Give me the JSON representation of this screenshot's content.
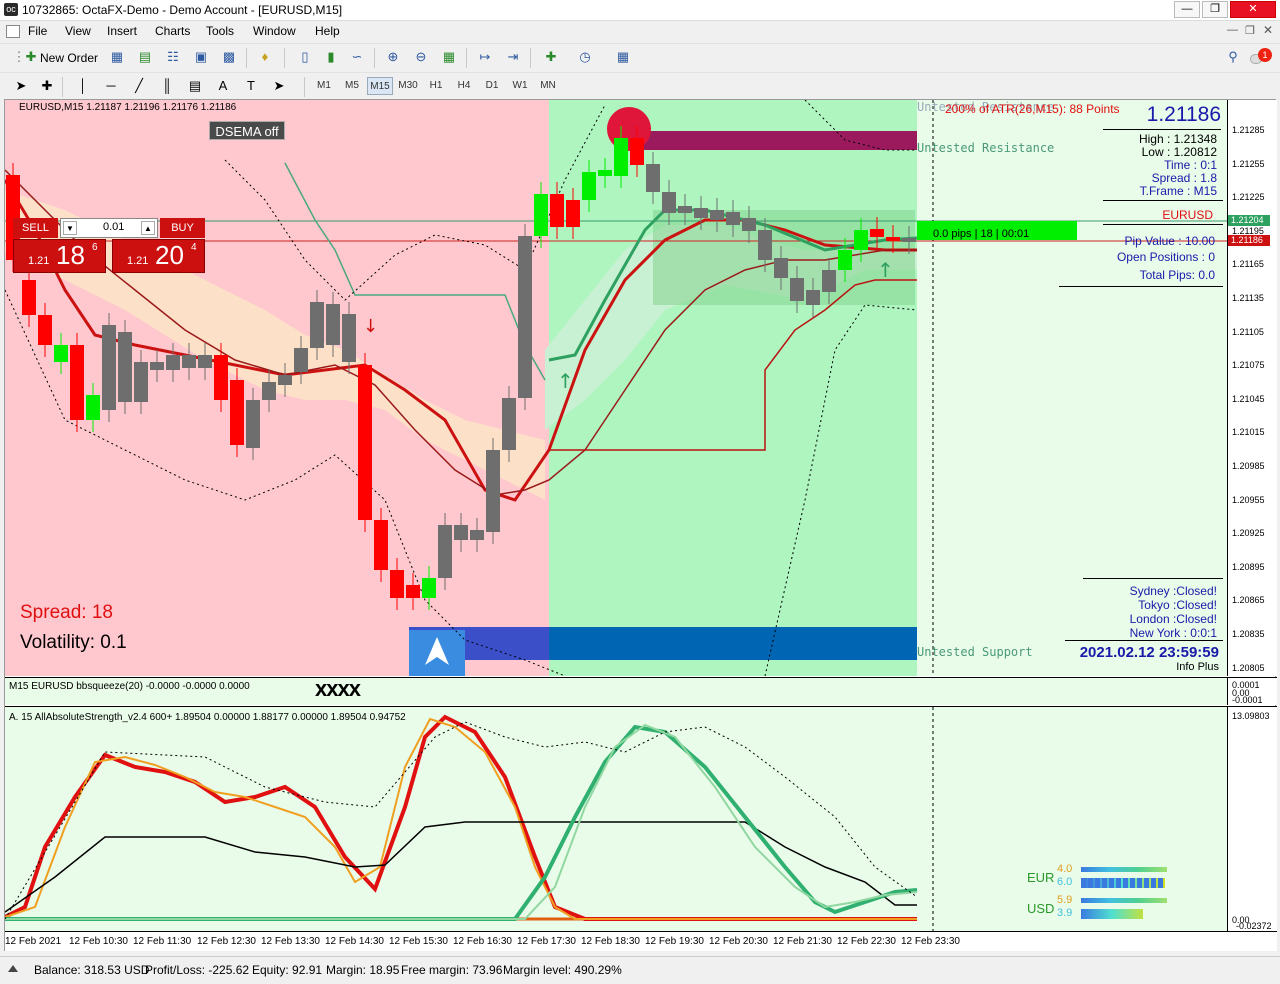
{
  "window": {
    "title": "10732865: OctaFX-Demo - Demo Account - [EURUSD,M15]",
    "app_icon": "oc"
  },
  "menu": [
    "File",
    "View",
    "Insert",
    "Charts",
    "Tools",
    "Window",
    "Help"
  ],
  "toolbar": {
    "new_order": "New Order"
  },
  "timeframes": [
    "M1",
    "M5",
    "M15",
    "M30",
    "H1",
    "H4",
    "D1",
    "W1",
    "MN"
  ],
  "active_timeframe": "M15",
  "chart": {
    "header": "EURUSD,M15  1.21187 1.21196 1.21176 1.21186",
    "dsema_button": "DSEMA off",
    "trade": {
      "sell_label": "SELL",
      "buy_label": "BUY",
      "lot": "0.01",
      "sell_small": "1.21",
      "sell_big": "18",
      "sell_sup": "6",
      "buy_small": "1.21",
      "buy_big": "20",
      "buy_sup": "4"
    },
    "spread_label": "Spread: 18",
    "volatility_label": "Volatility: 0.1",
    "atr_label": "200% of ATR(26,M15): 88  Points",
    "untested_resistance": "Untested Resistance",
    "untested_support": "Untested Support",
    "untested_top": "Untested Resistance",
    "pips_bar": "0.0 pips | 18 | 00:01",
    "info": {
      "price": "1.21186",
      "high": "High : 1.21348",
      "low": "Low : 1.20812",
      "time": "Time :      0:1",
      "spread": "Spread :       1.8",
      "tframe": "T.Frame :    M15",
      "symbol": "EURUSD",
      "pip_value": "Pip Value :   10.00",
      "open_positions": "Open Positions :       0",
      "total_pips": "Total Pips:      0.0"
    },
    "sessions": {
      "sydney": "Sydney :Closed!",
      "tokyo": "Tokyo :Closed!",
      "london": "London :Closed!",
      "newyork": "New York :     0:0:1",
      "datetime": "2021.02.12 23:59:59",
      "info_plus": "Info Plus"
    }
  },
  "price_scale": [
    "1.21285",
    "1.21255",
    "1.21225",
    "1.21195",
    "1.21165",
    "1.21135",
    "1.21105",
    "1.21075",
    "1.21045",
    "1.21015",
    "1.20985",
    "1.20955",
    "1.20925",
    "1.20895",
    "1.20865",
    "1.20835",
    "1.20805"
  ],
  "price_tags": {
    "green": "1.21204",
    "red": "1.21186"
  },
  "sub1": {
    "label": "M15 EURUSD bbsqueeze(20) -0.0000 -0.0000 0.0000",
    "marks": "xxxx",
    "scale": [
      "0.0001",
      "0.00",
      "-0.0001"
    ]
  },
  "sub2": {
    "label": "A. 15 AllAbsoluteStrength_v2.4 600+ 1.89504 0.00000 1.88177 0.00000 1.89504 0.94752",
    "scale_top": "13.09803",
    "scale_bottom": "0.00",
    "scale_bottom2": "-0.02372",
    "strength": {
      "eur_label": "EUR",
      "usd_label": "USD",
      "eur_v1": "4.0",
      "eur_v2": "6.0",
      "usd_v1": "5.9",
      "usd_v2": "3.9"
    }
  },
  "time_axis": [
    "12 Feb 2021",
    "12 Feb 10:30",
    "12 Feb 11:30",
    "12 Feb 12:30",
    "12 Feb 13:30",
    "12 Feb 14:30",
    "12 Feb 15:30",
    "12 Feb 16:30",
    "12 Feb 17:30",
    "12 Feb 18:30",
    "12 Feb 19:30",
    "12 Feb 20:30",
    "12 Feb 21:30",
    "12 Feb 22:30",
    "12 Feb 23:30"
  ],
  "status": {
    "balance": "Balance: 318.53 USD",
    "profit": "Profit/Loss: -225.62",
    "equity": "Equity: 92.91",
    "margin": "Margin: 18.95",
    "free_margin": "Free margin: 73.96",
    "margin_level": "Margin level: 490.29%"
  },
  "colors": {
    "bear": "#ff0000",
    "bull": "#00ee00",
    "neutral": "#6e6e6e",
    "pink_zone": "#ffc8cf",
    "green_zone": "#aef5c0",
    "support": "#0066b3",
    "resistance": "#9b1a5e"
  }
}
